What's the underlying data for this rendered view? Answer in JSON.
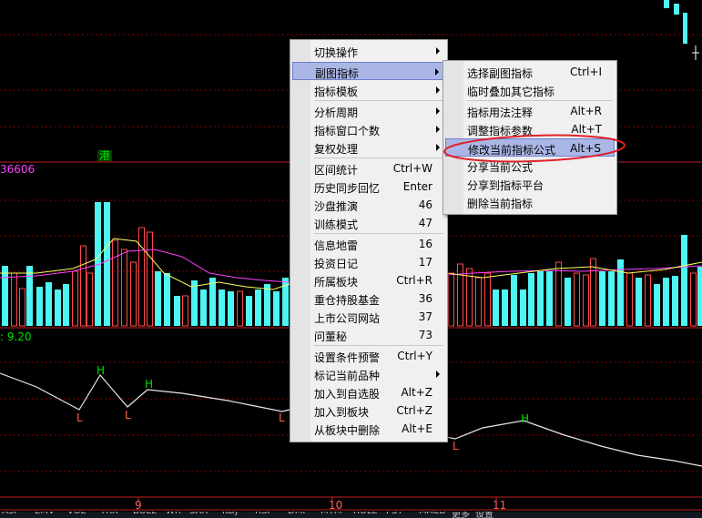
{
  "chart": {
    "badge": "港",
    "value_left": "36606",
    "indicator_value": ": 9.20",
    "hl_labels": [
      "L",
      "H",
      "L",
      "H",
      "L",
      "L",
      "H"
    ],
    "axis_dates": [
      "9",
      "10",
      "11"
    ]
  },
  "main_menu": {
    "items": [
      {
        "label": "切换操作",
        "shortcut": "",
        "submenu": true
      },
      {
        "label": "副图指标",
        "shortcut": "",
        "submenu": true,
        "highlighted": true
      },
      {
        "label": "指标模板",
        "shortcut": "",
        "submenu": true
      },
      {
        "label": "分析周期",
        "shortcut": "",
        "submenu": true
      },
      {
        "label": "指标窗口个数",
        "shortcut": "",
        "submenu": true
      },
      {
        "label": "复权处理",
        "shortcut": "",
        "submenu": true
      },
      {
        "label": "区间统计",
        "shortcut": "Ctrl+W"
      },
      {
        "label": "历史同步回忆",
        "shortcut": "Enter"
      },
      {
        "label": "沙盘推演",
        "shortcut": "46"
      },
      {
        "label": "训练模式",
        "shortcut": "47"
      },
      {
        "label": "信息地雷",
        "shortcut": "16"
      },
      {
        "label": "投资日记",
        "shortcut": "17"
      },
      {
        "label": "所属板块",
        "shortcut": "Ctrl+R"
      },
      {
        "label": "重仓持股基金",
        "shortcut": "36"
      },
      {
        "label": "上市公司网站",
        "shortcut": "37"
      },
      {
        "label": "问董秘",
        "shortcut": "73"
      },
      {
        "label": "设置条件预警",
        "shortcut": "Ctrl+Y"
      },
      {
        "label": "标记当前品种",
        "shortcut": "",
        "submenu": true
      },
      {
        "label": "加入到自选股",
        "shortcut": "Alt+Z"
      },
      {
        "label": "加入到板块",
        "shortcut": "Ctrl+Z"
      },
      {
        "label": "从板块中删除",
        "shortcut": "Alt+E"
      }
    ]
  },
  "sub_menu": {
    "items": [
      {
        "label": "选择副图指标",
        "shortcut": "Ctrl+I"
      },
      {
        "label": "临时叠加其它指标",
        "shortcut": ""
      },
      {
        "label": "指标用法注释",
        "shortcut": "Alt+R"
      },
      {
        "label": "调整指标参数",
        "shortcut": "Alt+T"
      },
      {
        "label": "修改当前指标公式",
        "shortcut": "Alt+S",
        "highlighted": true
      },
      {
        "label": "分享当前公式",
        "shortcut": ""
      },
      {
        "label": "分享到指标平台",
        "shortcut": ""
      },
      {
        "label": "删除当前指标",
        "shortcut": ""
      }
    ]
  },
  "bottom_tabs": [
    "ASI",
    "EMV",
    "VOL",
    "TRX",
    "BOLL",
    "WR",
    "SAR",
    "KDJ",
    "RSI",
    "DMI",
    "MTM",
    "ROLL",
    "PSY",
    "MACD",
    "更多",
    "设置"
  ],
  "colors": {
    "cyan_bar": "#4df5f5",
    "red_bar": "#ff4a4a",
    "yellow_line": "#ffff60",
    "magenta_line": "#ff40ff",
    "grid": "#8a0000",
    "highlight": "#aab7e6",
    "annotation": "#e0202a"
  }
}
